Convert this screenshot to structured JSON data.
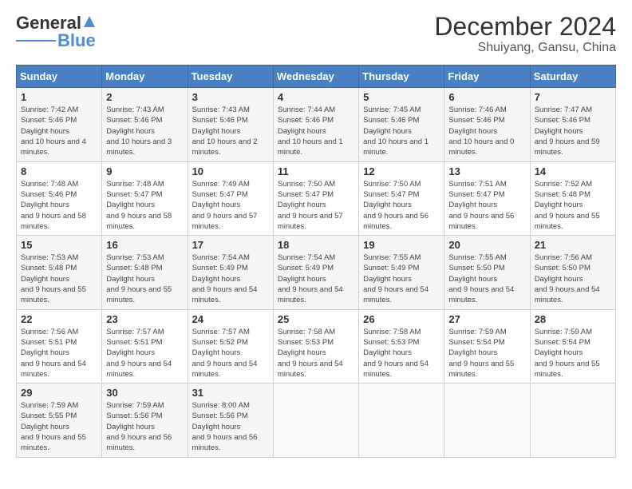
{
  "logo": {
    "line1": "General",
    "line2": "Blue"
  },
  "header": {
    "month": "December 2024",
    "location": "Shuiyang, Gansu, China"
  },
  "weekdays": [
    "Sunday",
    "Monday",
    "Tuesday",
    "Wednesday",
    "Thursday",
    "Friday",
    "Saturday"
  ],
  "weeks": [
    [
      {
        "day": 1,
        "sunrise": "7:42 AM",
        "sunset": "5:46 PM",
        "daylight": "10 hours and 4 minutes."
      },
      {
        "day": 2,
        "sunrise": "7:43 AM",
        "sunset": "5:46 PM",
        "daylight": "10 hours and 3 minutes."
      },
      {
        "day": 3,
        "sunrise": "7:43 AM",
        "sunset": "5:46 PM",
        "daylight": "10 hours and 2 minutes."
      },
      {
        "day": 4,
        "sunrise": "7:44 AM",
        "sunset": "5:46 PM",
        "daylight": "10 hours and 1 minute."
      },
      {
        "day": 5,
        "sunrise": "7:45 AM",
        "sunset": "5:46 PM",
        "daylight": "10 hours and 1 minute."
      },
      {
        "day": 6,
        "sunrise": "7:46 AM",
        "sunset": "5:46 PM",
        "daylight": "10 hours and 0 minutes."
      },
      {
        "day": 7,
        "sunrise": "7:47 AM",
        "sunset": "5:46 PM",
        "daylight": "9 hours and 59 minutes."
      }
    ],
    [
      {
        "day": 8,
        "sunrise": "7:48 AM",
        "sunset": "5:46 PM",
        "daylight": "9 hours and 58 minutes."
      },
      {
        "day": 9,
        "sunrise": "7:48 AM",
        "sunset": "5:47 PM",
        "daylight": "9 hours and 58 minutes."
      },
      {
        "day": 10,
        "sunrise": "7:49 AM",
        "sunset": "5:47 PM",
        "daylight": "9 hours and 57 minutes."
      },
      {
        "day": 11,
        "sunrise": "7:50 AM",
        "sunset": "5:47 PM",
        "daylight": "9 hours and 57 minutes."
      },
      {
        "day": 12,
        "sunrise": "7:50 AM",
        "sunset": "5:47 PM",
        "daylight": "9 hours and 56 minutes."
      },
      {
        "day": 13,
        "sunrise": "7:51 AM",
        "sunset": "5:47 PM",
        "daylight": "9 hours and 56 minutes."
      },
      {
        "day": 14,
        "sunrise": "7:52 AM",
        "sunset": "5:48 PM",
        "daylight": "9 hours and 55 minutes."
      }
    ],
    [
      {
        "day": 15,
        "sunrise": "7:53 AM",
        "sunset": "5:48 PM",
        "daylight": "9 hours and 55 minutes."
      },
      {
        "day": 16,
        "sunrise": "7:53 AM",
        "sunset": "5:48 PM",
        "daylight": "9 hours and 55 minutes."
      },
      {
        "day": 17,
        "sunrise": "7:54 AM",
        "sunset": "5:49 PM",
        "daylight": "9 hours and 54 minutes."
      },
      {
        "day": 18,
        "sunrise": "7:54 AM",
        "sunset": "5:49 PM",
        "daylight": "9 hours and 54 minutes."
      },
      {
        "day": 19,
        "sunrise": "7:55 AM",
        "sunset": "5:49 PM",
        "daylight": "9 hours and 54 minutes."
      },
      {
        "day": 20,
        "sunrise": "7:55 AM",
        "sunset": "5:50 PM",
        "daylight": "9 hours and 54 minutes."
      },
      {
        "day": 21,
        "sunrise": "7:56 AM",
        "sunset": "5:50 PM",
        "daylight": "9 hours and 54 minutes."
      }
    ],
    [
      {
        "day": 22,
        "sunrise": "7:56 AM",
        "sunset": "5:51 PM",
        "daylight": "9 hours and 54 minutes."
      },
      {
        "day": 23,
        "sunrise": "7:57 AM",
        "sunset": "5:51 PM",
        "daylight": "9 hours and 54 minutes."
      },
      {
        "day": 24,
        "sunrise": "7:57 AM",
        "sunset": "5:52 PM",
        "daylight": "9 hours and 54 minutes."
      },
      {
        "day": 25,
        "sunrise": "7:58 AM",
        "sunset": "5:53 PM",
        "daylight": "9 hours and 54 minutes."
      },
      {
        "day": 26,
        "sunrise": "7:58 AM",
        "sunset": "5:53 PM",
        "daylight": "9 hours and 54 minutes."
      },
      {
        "day": 27,
        "sunrise": "7:59 AM",
        "sunset": "5:54 PM",
        "daylight": "9 hours and 55 minutes."
      },
      {
        "day": 28,
        "sunrise": "7:59 AM",
        "sunset": "5:54 PM",
        "daylight": "9 hours and 55 minutes."
      }
    ],
    [
      {
        "day": 29,
        "sunrise": "7:59 AM",
        "sunset": "5:55 PM",
        "daylight": "9 hours and 55 minutes."
      },
      {
        "day": 30,
        "sunrise": "7:59 AM",
        "sunset": "5:56 PM",
        "daylight": "9 hours and 56 minutes."
      },
      {
        "day": 31,
        "sunrise": "8:00 AM",
        "sunset": "5:56 PM",
        "daylight": "9 hours and 56 minutes."
      },
      null,
      null,
      null,
      null
    ]
  ]
}
